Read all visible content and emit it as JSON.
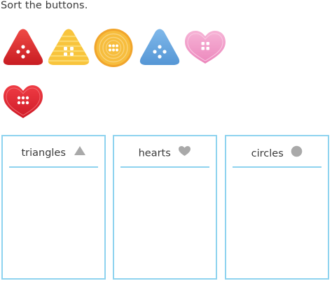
{
  "prompt": "Sort the buttons.",
  "buttons": [
    {
      "shape": "triangle",
      "color": "#dd2a2a",
      "holes": 4
    },
    {
      "shape": "triangle",
      "color": "#f7c33a",
      "holes": 4
    },
    {
      "shape": "circle",
      "color": "#f5b335",
      "holes": 6
    },
    {
      "shape": "triangle",
      "color": "#6ba8e0",
      "holes": 4
    },
    {
      "shape": "heart",
      "color": "#f19ac8",
      "holes": 4
    },
    {
      "shape": "heart",
      "color": "#e02733",
      "holes": 6
    }
  ],
  "bins": [
    {
      "label": "triangles",
      "icon": "triangle-icon"
    },
    {
      "label": "hearts",
      "icon": "heart-icon"
    },
    {
      "label": "circles",
      "icon": "circle-icon"
    }
  ],
  "colors": {
    "bin_border": "#8ed3ef",
    "icon_gray": "#a9a9a9"
  }
}
